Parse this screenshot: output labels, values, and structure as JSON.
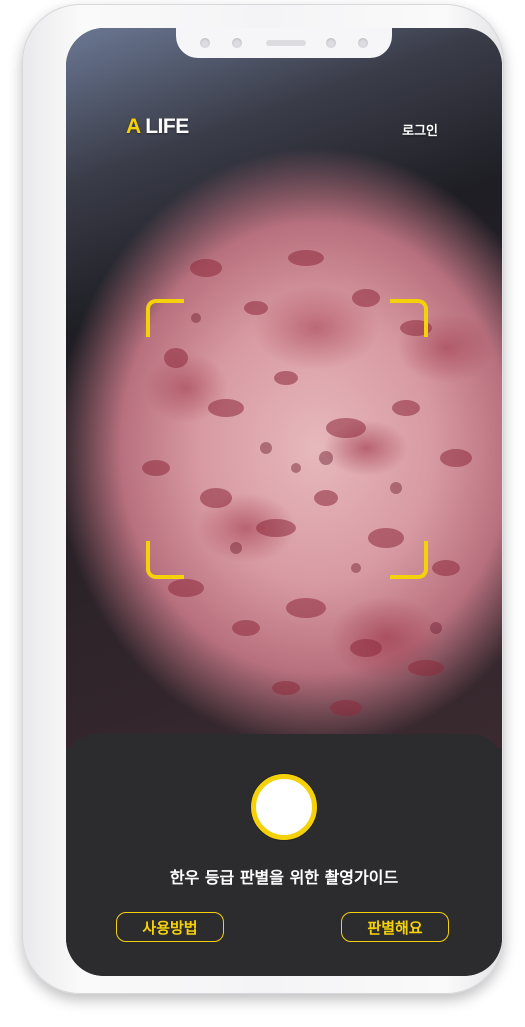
{
  "header": {
    "brand_accent": "A",
    "brand_rest": " LIFE",
    "login_label": "로그인"
  },
  "camera": {
    "frame_guide_icon": "viewfinder-corners-icon",
    "shutter_icon": "shutter-button-icon"
  },
  "bottom_panel": {
    "guide_text": "한우 등급 판별을 위한 촬영가이드",
    "how_to_label": "사용방법",
    "judge_label": "판별해요"
  },
  "colors": {
    "accent": "#f5d10a",
    "panel": "#2c2c2e",
    "text": "#ffffff"
  }
}
